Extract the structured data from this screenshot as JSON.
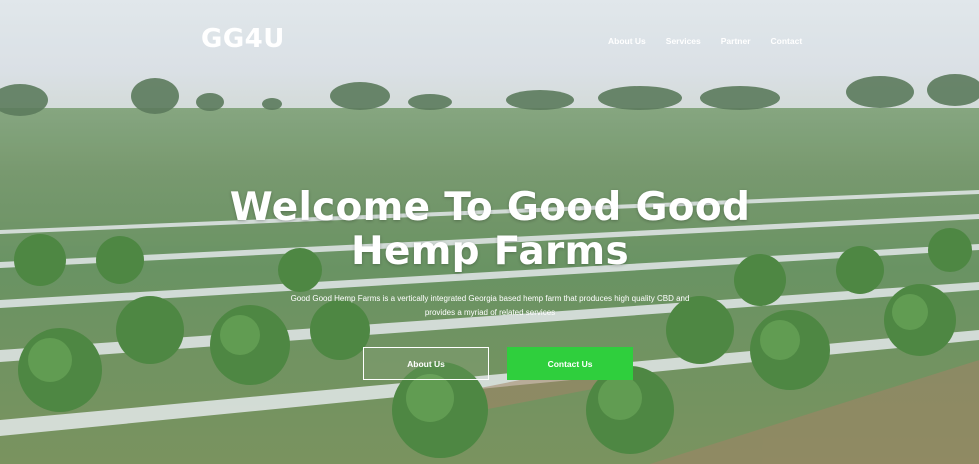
{
  "brand": {
    "logo": "GG4U"
  },
  "nav": {
    "items": [
      {
        "label": "About Us"
      },
      {
        "label": "Services"
      },
      {
        "label": "Partner"
      },
      {
        "label": "Contact"
      }
    ]
  },
  "hero": {
    "headline_line1": "Welcome To Good Good",
    "headline_line2": "Hemp Farms",
    "subtitle": "Good Good Hemp Farms is a vertically integrated Georgia based hemp farm that produces high quality CBD and provides a myriad of related services",
    "buttons": {
      "about_label": "About Us",
      "contact_label": "Contact Us"
    }
  },
  "colors": {
    "accent_green": "#2fcf3d",
    "text_white": "#ffffff"
  }
}
